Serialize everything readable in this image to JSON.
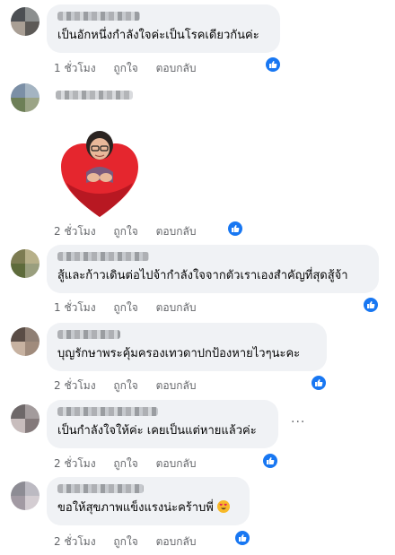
{
  "comments": [
    {
      "text": "เป็นอักหนึ่งกำลังใจค่ะเป็นโรคเดียวกันค่ะ",
      "time": "1 ชั่วโมง",
      "like": "ถูกใจ",
      "reply": "ตอบกลับ"
    },
    {
      "text": "",
      "time": "2 ชั่วโมง",
      "like": "ถูกใจ",
      "reply": "ตอบกลับ"
    },
    {
      "text": "สู้และก้าวเดินต่อไปจ้ากำลังใจจากตัวเราเองสำคัญที่สุดสู้จ้า",
      "time": "1 ชั่วโมง",
      "like": "ถูกใจ",
      "reply": "ตอบกลับ"
    },
    {
      "text": "บุญรักษาพระคุ้มครองเทวดาปกป้องหายไวๆนะคะ",
      "time": "2 ชั่วโมง",
      "like": "ถูกใจ",
      "reply": "ตอบกลับ"
    },
    {
      "text": "เป็นกำลังใจให้ค่ะ เคยเป็นแต่หายแล้วค่ะ",
      "time": "2 ชั่วโมง",
      "like": "ถูกใจ",
      "reply": "ตอบกลับ"
    },
    {
      "text": "ขอให้สุขภาพแข็งแรงน่ะคร้าบพี่",
      "time": "2 ชั่วโมง",
      "like": "ถูกใจ",
      "reply": "ตอบกลับ"
    }
  ],
  "icons": {
    "reaction": "like-thumb-icon",
    "emoji": "heart-eyes-emoji-icon",
    "more": "more-options-icon",
    "sticker": "heart-hug-sticker"
  },
  "colors": {
    "accent": "#1877f2",
    "bubble": "#f0f2f5",
    "meta": "#65676b"
  },
  "more_glyph": "···"
}
